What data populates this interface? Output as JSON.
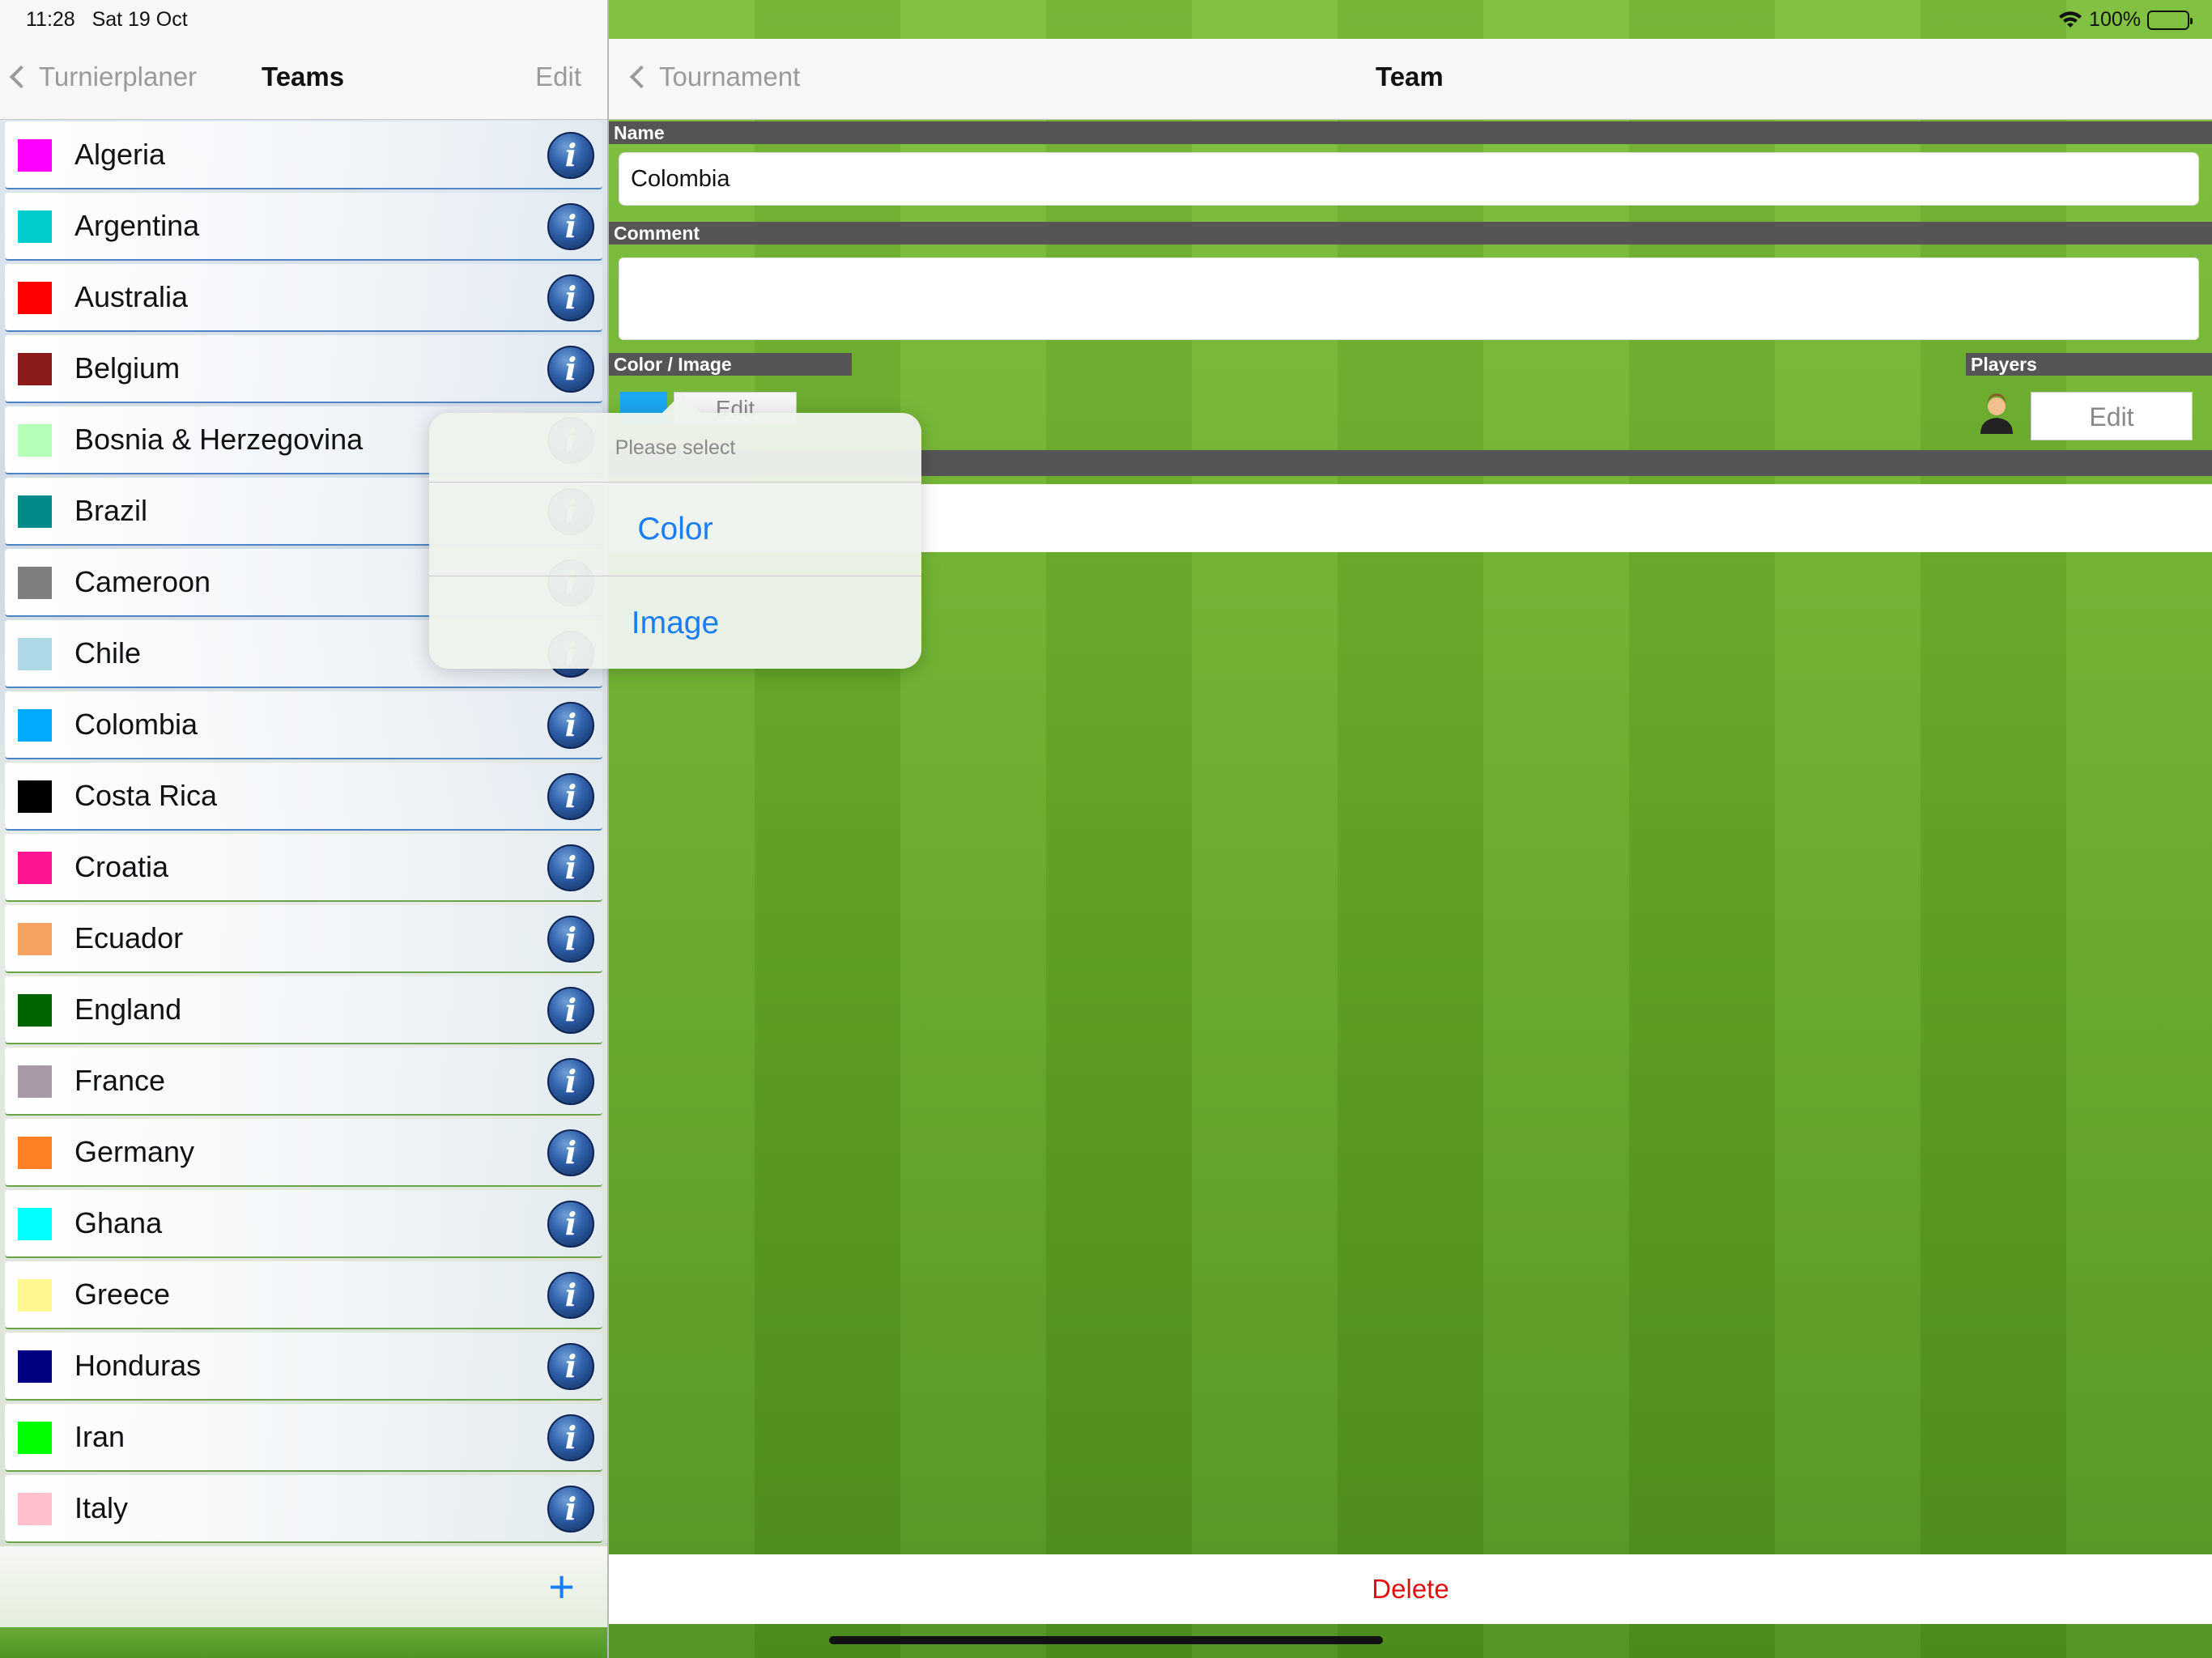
{
  "status": {
    "time": "11:28",
    "date": "Sat 19 Oct",
    "battery": "100%"
  },
  "left": {
    "back_label": "Turnierplaner",
    "title": "Teams",
    "edit_label": "Edit",
    "teams": [
      {
        "name": "Algeria",
        "color": "#ff00ff"
      },
      {
        "name": "Argentina",
        "color": "#00cccc"
      },
      {
        "name": "Australia",
        "color": "#ff0000"
      },
      {
        "name": "Belgium",
        "color": "#8b1a1a"
      },
      {
        "name": "Bosnia & Herzegovina",
        "color": "#b6ffb6"
      },
      {
        "name": "Brazil",
        "color": "#008b8b"
      },
      {
        "name": "Cameroon",
        "color": "#7f7f7f"
      },
      {
        "name": "Chile",
        "color": "#add8e6"
      },
      {
        "name": "Colombia",
        "color": "#00aaff"
      },
      {
        "name": "Costa Rica",
        "color": "#000000"
      },
      {
        "name": "Croatia",
        "color": "#ff1493"
      },
      {
        "name": "Ecuador",
        "color": "#f4a460"
      },
      {
        "name": "England",
        "color": "#006400"
      },
      {
        "name": "France",
        "color": "#a89aa8"
      },
      {
        "name": "Germany",
        "color": "#ff7f24"
      },
      {
        "name": "Ghana",
        "color": "#00ffff"
      },
      {
        "name": "Greece",
        "color": "#fff68f"
      },
      {
        "name": "Honduras",
        "color": "#000080"
      },
      {
        "name": "Iran",
        "color": "#00ff00"
      },
      {
        "name": "Italy",
        "color": "#ffc0cb"
      }
    ],
    "info_glyph": "i",
    "add_glyph": "+"
  },
  "right": {
    "back_label": "Tournament",
    "title": "Team",
    "name_label": "Name",
    "name_value": "Colombia",
    "comment_label": "Comment",
    "comment_value": "",
    "color_image_label": "Color / Image",
    "color_chip": "#1aa7ef",
    "color_edit_label": "Edit",
    "players_label": "Players",
    "players_edit_label": "Edit",
    "delete_label": "Delete"
  },
  "popover": {
    "header": "Please select",
    "options": [
      "Color",
      "Image"
    ]
  }
}
